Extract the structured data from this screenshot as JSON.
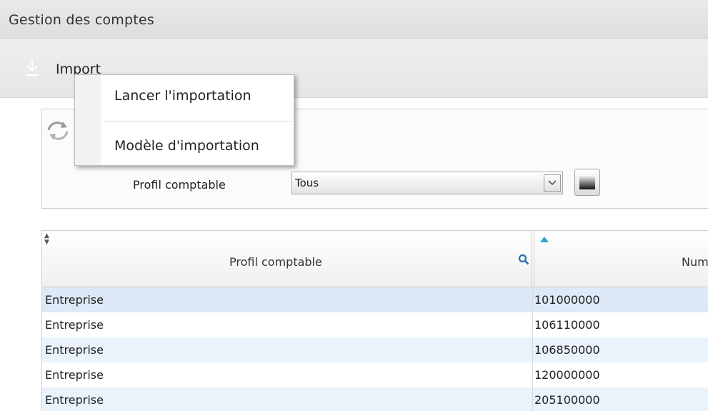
{
  "window": {
    "title": "Gestion des comptes"
  },
  "toolbar": {
    "import_label": "Import",
    "import_icon": "download-icon"
  },
  "context_menu": {
    "items": [
      {
        "label": "Lancer l'importation"
      },
      {
        "label": "Modèle d'importation"
      }
    ]
  },
  "filter": {
    "label": "Profil comptable",
    "selected_value": "Tous",
    "refresh_icon": "refresh-icon",
    "export_icon": "export-icon"
  },
  "grid": {
    "columns": [
      {
        "title": "Profil comptable",
        "sort": "none",
        "filter_icon": "search-icon"
      },
      {
        "title": "Num",
        "sort": "ascending"
      }
    ],
    "rows": [
      {
        "profil": "Entreprise",
        "numero": "101000000"
      },
      {
        "profil": "Entreprise",
        "numero": "106110000"
      },
      {
        "profil": "Entreprise",
        "numero": "106850000"
      },
      {
        "profil": "Entreprise",
        "numero": "120000000"
      },
      {
        "profil": "Entreprise",
        "numero": "205100000"
      }
    ]
  },
  "colors": {
    "selected_row": "#dde9f6",
    "alt_row": "#eaf2fb",
    "sort_arrow": "#2aa6c8",
    "search_icon": "#2b6fb3"
  }
}
